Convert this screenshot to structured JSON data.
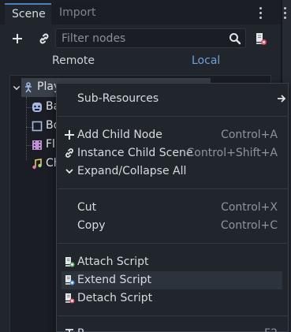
{
  "tabs": {
    "scene": "Scene",
    "import": "Import"
  },
  "toolbar": {
    "filter_placeholder": "Filter nodes"
  },
  "mode": {
    "remote": "Remote",
    "local": "Local"
  },
  "tree": {
    "root_label": "Play",
    "children": [
      {
        "label": "Ba",
        "icon": "sprite-icon"
      },
      {
        "label": "Bo",
        "icon": "collision-shape-icon"
      },
      {
        "label": "Fl",
        "icon": "animated-sprite-icon"
      },
      {
        "label": "Ch",
        "icon": "audio-player-icon"
      }
    ]
  },
  "context_menu": {
    "sub_resources": "Sub-Resources",
    "add_child_node": "Add Child Node",
    "add_child_node_shortcut": "Control+A",
    "instance_child_scene": "Instance Child Scene",
    "instance_child_scene_shortcut": "Control+Shift+A",
    "expand_collapse_all": "Expand/Collapse All",
    "cut": "Cut",
    "cut_shortcut": "Control+X",
    "copy": "Copy",
    "copy_shortcut": "Control+C",
    "attach_script": "Attach Script",
    "extend_script": "Extend Script",
    "detach_script": "Detach Script",
    "rename_partial": "R",
    "rename_shortcut_partial": "F2"
  },
  "colors": {
    "accent": "#6f9fd8",
    "panel_bg": "#21262d",
    "menu_highlight": "#2d333c"
  }
}
